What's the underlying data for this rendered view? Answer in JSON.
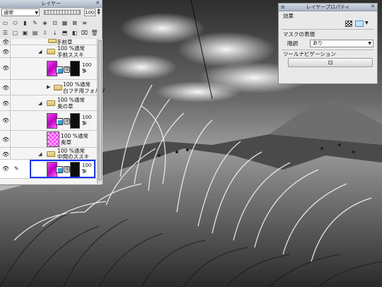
{
  "layer_panel": {
    "title": "レイヤー",
    "blend_mode": "通常",
    "opacity": "100",
    "layers": [
      {
        "name": "手前草",
        "kind": "folder-partial"
      },
      {
        "opacity": "100 %通常",
        "name": "手前ススキ",
        "kind": "folder"
      },
      {
        "opacity_top": "100 %",
        "opacity_num": "3",
        "kind": "layer"
      },
      {
        "opacity": "100 %通常",
        "name": "白フチ用フォルダ",
        "kind": "folder-collapsed"
      },
      {
        "opacity": "100 %通常",
        "name": "奥の草",
        "kind": "folder"
      },
      {
        "opacity_top": "100 %",
        "opacity_num": "3",
        "kind": "layer"
      },
      {
        "opacity": "100 %通常",
        "name": "奥草",
        "kind": "layer-color"
      },
      {
        "opacity": "100 %通常",
        "name": "中間のススキ",
        "kind": "folder"
      },
      {
        "opacity_top": "100 %",
        "opacity_num": "3",
        "kind": "layer-selected"
      }
    ]
  },
  "property_panel": {
    "title": "レイヤープロパティ",
    "effect_label": "効果",
    "mask_section": "マスクの表現",
    "gradation_label": "階調",
    "gradation_value": "あり",
    "tool_nav_label": "ツールナビゲーション"
  },
  "icons": {
    "eye": "eye-icon",
    "folder": "folder-icon",
    "chain": "link-icon",
    "mask": "mask-icon",
    "nav_button": "navigation-icon"
  },
  "colors": {
    "selection_box": "#1234ff",
    "magenta_thumb": "#ff3dff",
    "sky_dark": "#3a3a3a"
  }
}
